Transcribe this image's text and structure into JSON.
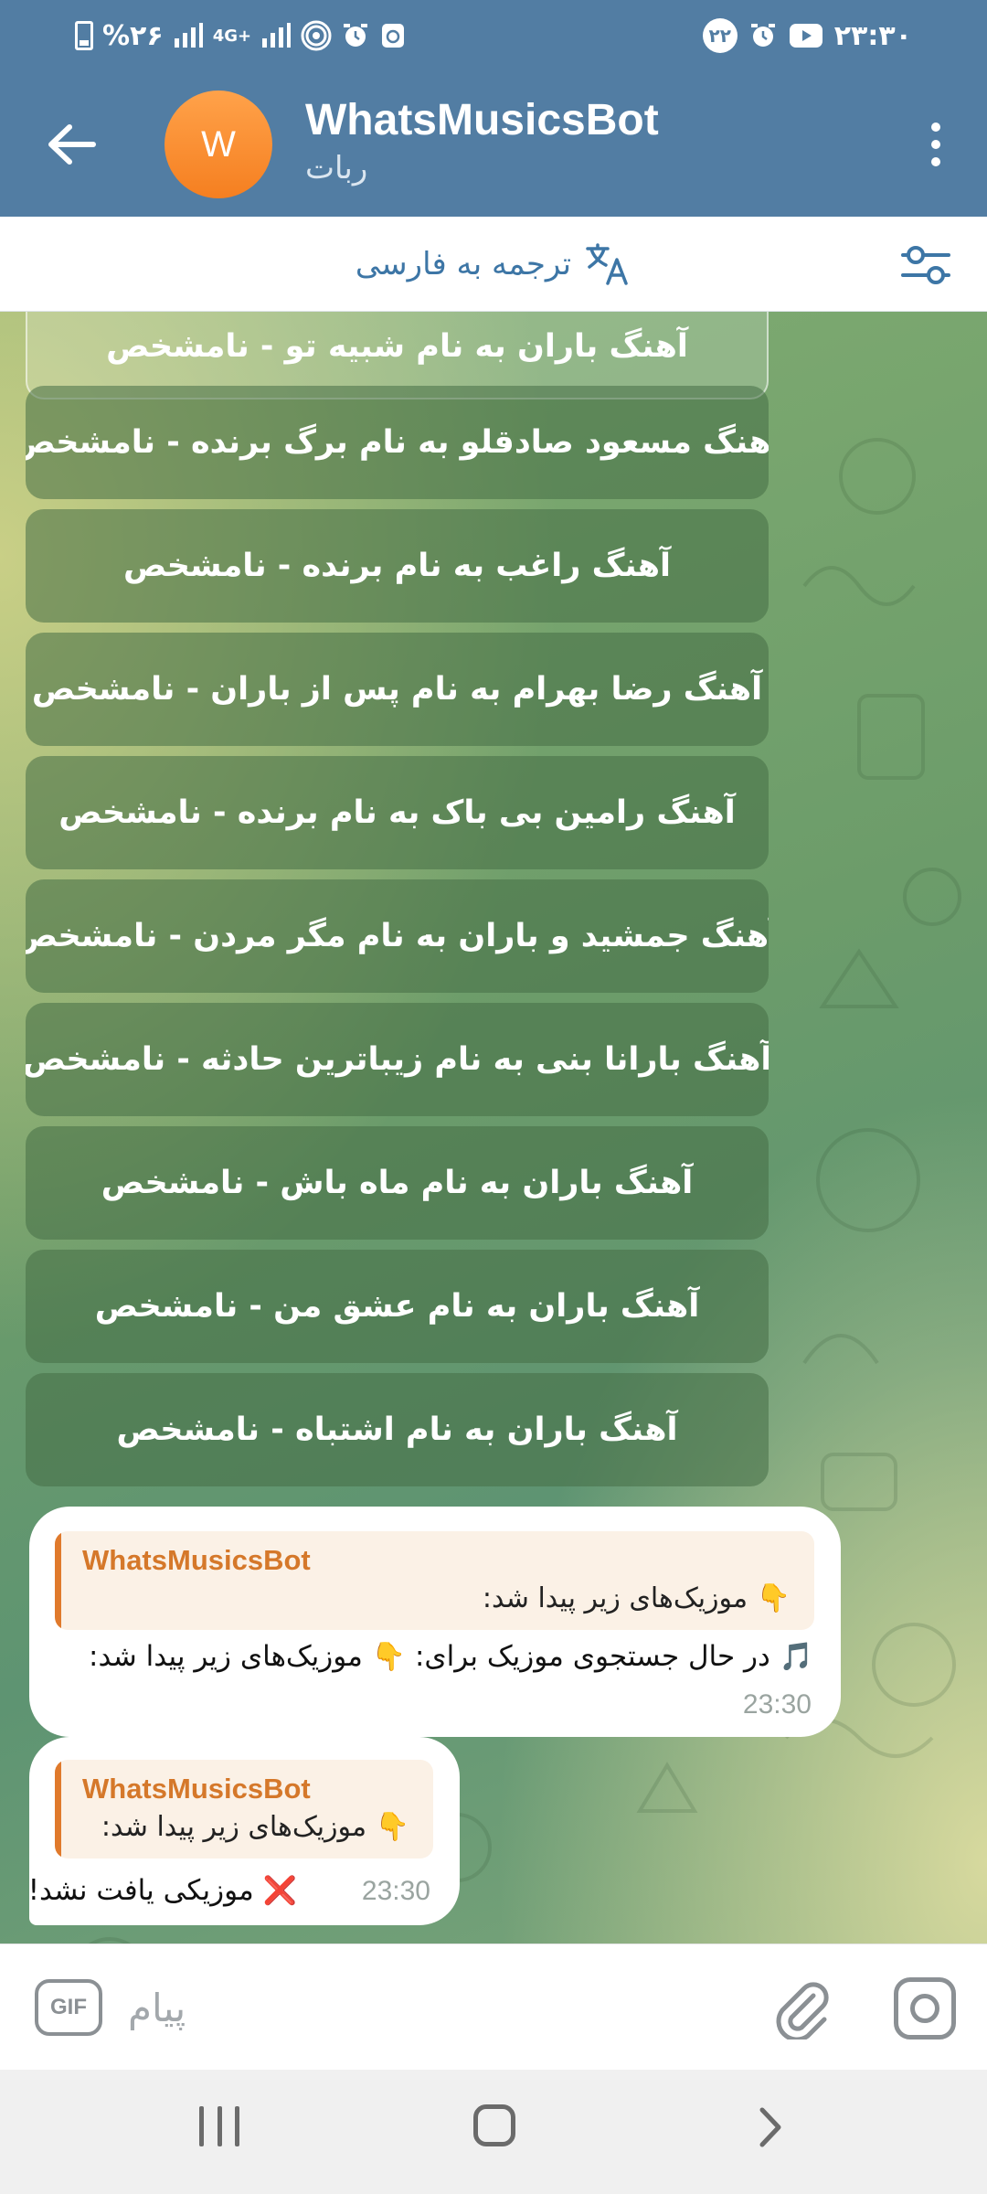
{
  "status_bar": {
    "left_text": "%۲۶",
    "network_label": "4G+",
    "right_time": "۲۳:۳۰",
    "notification_count": "۲۲"
  },
  "header": {
    "title": "WhatsMusicsBot",
    "subtitle": "ربات",
    "avatar_letter": "W",
    "avatar_color": "#f7902f",
    "header_color": "#527da3"
  },
  "translate_bar": {
    "label": "ترجمه به فارسی"
  },
  "keyboard_buttons": [
    "آهنگ باران به نام شبیه تو - نامشخص",
    "آهنگ مسعود صادقلو به نام برگ برنده - نامشخص",
    "آهنگ راغب به نام برنده - نامشخص",
    "آهنگ رضا بهرام به نام پس از باران - نامشخص",
    "آهنگ رامین بی باک به نام برنده - نامشخص",
    "آهنگ جمشید و باران به نام مگر مردن - نامشخص",
    "آهنگ بارانا بنی به نام زیباترین حادثه - نامشخص",
    "آهنگ باران به نام ماه باش - نامشخص",
    "آهنگ باران به نام عشق من - نامشخص",
    "آهنگ باران به نام اشتباه - نامشخص"
  ],
  "messages": [
    {
      "reply_name": "WhatsMusicsBot",
      "reply_text": "موزیک‌های زیر پیدا شد:",
      "reply_emoji": "👇",
      "lead_emoji": "🎵",
      "text": "در حال جستجوی موزیک برای:",
      "inline_emoji": "👇",
      "text_tail": "موزیک‌های زیر پیدا شد:",
      "time": "23:30"
    },
    {
      "reply_name": "WhatsMusicsBot",
      "reply_text": "موزیک‌های زیر پیدا شد:",
      "reply_emoji": "👇",
      "lead_emoji": "❌",
      "text": "موزیکی یافت نشد!",
      "time": "23:30"
    }
  ],
  "input": {
    "placeholder": "پیام",
    "gif_label": "GIF"
  }
}
